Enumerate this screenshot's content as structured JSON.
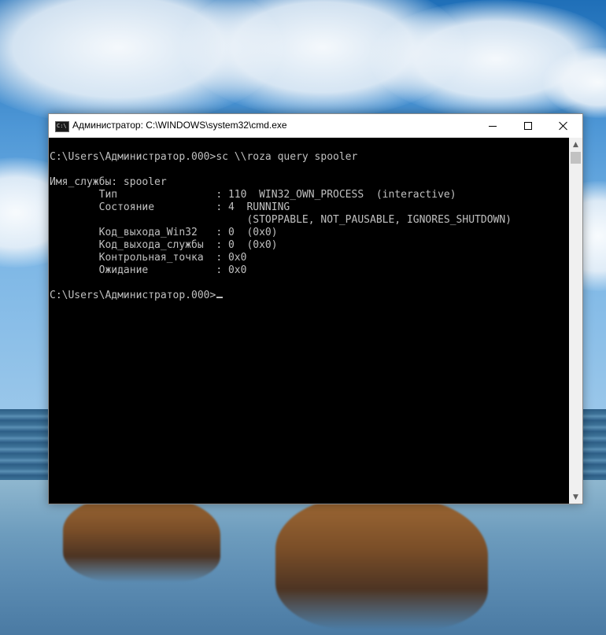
{
  "window": {
    "title": "Администратор: C:\\WINDOWS\\system32\\cmd.exe",
    "icon": "cmd-icon",
    "icon_text": "C:\\"
  },
  "console": {
    "lines": [
      "C:\\Users\\Администратор.000>sc \\\\roza query spooler",
      "",
      "Имя_службы: spooler",
      "        Тип                : 110  WIN32_OWN_PROCESS  (interactive)",
      "        Состояние          : 4  RUNNING",
      "                                (STOPPABLE, NOT_PAUSABLE, IGNORES_SHUTDOWN)",
      "        Код_выхода_Win32   : 0  (0x0)",
      "        Код_выхода_службы  : 0  (0x0)",
      "        Контрольная_точка  : 0x0",
      "        Ожидание           : 0x0",
      ""
    ],
    "prompt": "C:\\Users\\Администратор.000>"
  },
  "colors": {
    "console_background": "#000000",
    "console_text": "#c0c0c0",
    "titlebar_background": "#ffffff"
  }
}
